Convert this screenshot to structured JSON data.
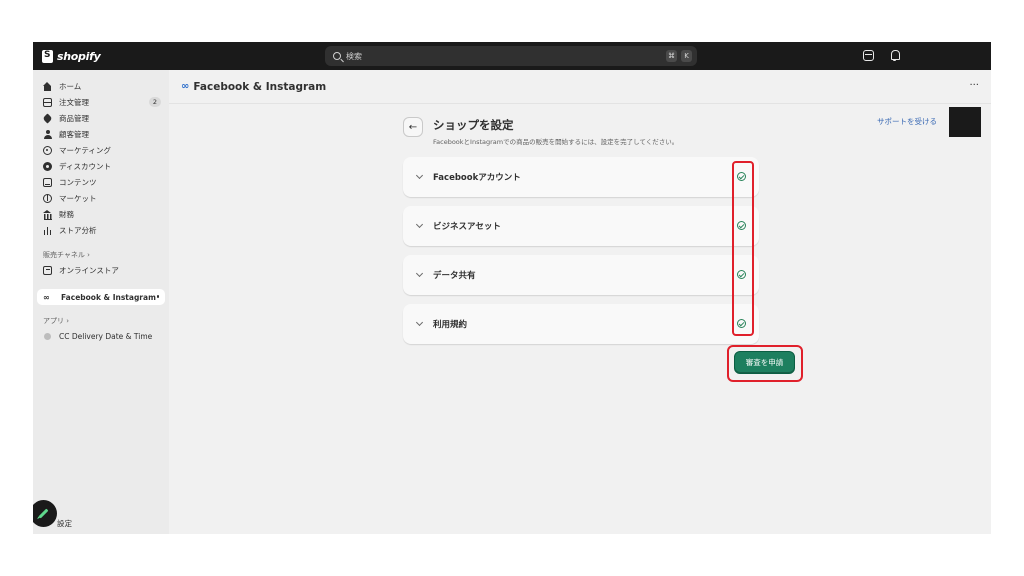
{
  "topbar": {
    "logo_text": "shopify",
    "search_placeholder": "検索",
    "shortcut_cmd": "⌘",
    "shortcut_k": "K"
  },
  "sidebar": {
    "items": [
      {
        "label": "ホーム",
        "icon": "home-icon"
      },
      {
        "label": "注文管理",
        "icon": "orders-icon",
        "badge": "2"
      },
      {
        "label": "商品管理",
        "icon": "tag-icon"
      },
      {
        "label": "顧客管理",
        "icon": "person-icon"
      },
      {
        "label": "マーケティング",
        "icon": "target-icon"
      },
      {
        "label": "ディスカウント",
        "icon": "discount-icon"
      },
      {
        "label": "コンテンツ",
        "icon": "content-icon"
      },
      {
        "label": "マーケット",
        "icon": "globe-icon"
      },
      {
        "label": "財務",
        "icon": "bank-icon"
      },
      {
        "label": "ストア分析",
        "icon": "chart-icon"
      }
    ],
    "sales_channels_label": "販売チャネル",
    "online_store": "オンラインストア",
    "active_app": "Facebook & Instagram",
    "apps_label": "アプリ",
    "app_item": "CC Delivery Date & Time",
    "settings": "設定"
  },
  "header": {
    "meta_symbol": "∞",
    "title": "Facebook & Instagram",
    "more": "···"
  },
  "page": {
    "back": "←",
    "title": "ショップを設定",
    "subtitle": "FacebookとInstagramでの商品の販売を開始するには、設定を完了してください。",
    "support_link": "サポートを受ける",
    "steps": [
      {
        "label": "Facebookアカウント",
        "status": "complete"
      },
      {
        "label": "ビジネスアセット",
        "status": "complete"
      },
      {
        "label": "データ共有",
        "status": "complete"
      },
      {
        "label": "利用規約",
        "status": "complete"
      }
    ],
    "submit": "審査を申請"
  },
  "colors": {
    "accent_green": "#1d7f5f",
    "highlight_red": "#e0202b",
    "link_blue": "#3868b3"
  }
}
